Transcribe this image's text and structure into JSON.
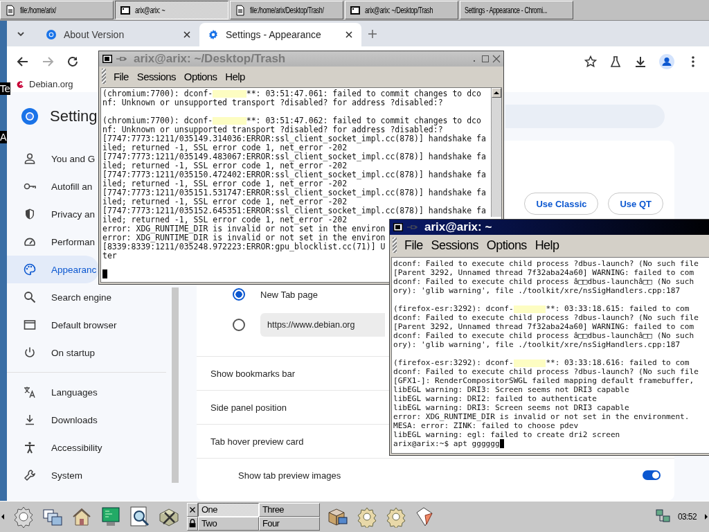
{
  "desktop": {
    "edge_labels": [
      "Te",
      "A"
    ]
  },
  "top_taskbar": {
    "tasks": [
      {
        "label": "file:/home/arix/",
        "kind": "document",
        "selected": false
      },
      {
        "label": "arix@arix: ~",
        "kind": "terminal",
        "selected": true
      },
      {
        "label": "file:/home/arix/Desktop/Trash/",
        "kind": "document",
        "selected": false
      },
      {
        "label": "arix@arix: ~/Desktop/Trash",
        "kind": "terminal",
        "selected": false
      },
      {
        "label": "Settings - Appearance - Chromi...",
        "kind": "none",
        "selected": false
      }
    ]
  },
  "browser": {
    "tabs": [
      {
        "label": "About Version",
        "kind": "chromium",
        "selected": false
      },
      {
        "label": "Settings - Appearance",
        "kind": "gear",
        "selected": true
      }
    ],
    "bookmarks": [
      {
        "label": "Debian.org"
      }
    ],
    "settings_title": "Setting",
    "sidebar": {
      "sections": [
        [
          {
            "label": "You and G",
            "kind": "person",
            "selected": false
          },
          {
            "label": "Autofill an",
            "kind": "key",
            "selected": false
          },
          {
            "label": "Privacy an",
            "kind": "shield",
            "selected": false
          },
          {
            "label": "Performan",
            "kind": "gauge",
            "selected": false
          },
          {
            "label": "Appearanc",
            "kind": "palette",
            "selected": true
          },
          {
            "label": "Search engine",
            "kind": "search",
            "selected": false
          },
          {
            "label": "Default browser",
            "kind": "browser",
            "selected": false
          },
          {
            "label": "On startup",
            "kind": "power",
            "selected": false
          }
        ],
        [
          {
            "label": "Languages",
            "kind": "translate",
            "selected": false
          },
          {
            "label": "Downloads",
            "kind": "download",
            "selected": false
          },
          {
            "label": "Accessibility",
            "kind": "accessibility",
            "selected": false
          },
          {
            "label": "System",
            "kind": "wrench",
            "selected": false
          }
        ]
      ]
    },
    "theme_buttons": [
      "Use Classic",
      "Use QT"
    ],
    "home_options": [
      {
        "label": "New Tab page",
        "kind": "text",
        "selected": true
      },
      {
        "label": "https://www.debian.org",
        "kind": "field",
        "selected": false
      }
    ],
    "rows": [
      {
        "label": "Show bookmarks bar",
        "kind": "plain"
      },
      {
        "label": "Side panel position",
        "kind": "plain"
      },
      {
        "label": "Tab hover preview card",
        "kind": "plain"
      },
      {
        "label": "Show tab preview images",
        "kind": "toggle",
        "on": true
      }
    ]
  },
  "terminals": [
    {
      "title": "arix@arix: ~/Desktop/Trash",
      "active": false,
      "menu": [
        "File",
        "Sessions",
        "Options",
        "Help"
      ],
      "lines": [
        {
          "kind": "redacted",
          "before": "(chromium:7700): dconf-",
          "after": "**: 03:51:47.061: failed to commit changes to dco"
        },
        {
          "kind": "text",
          "text": "nf: Unknown or unsupported transport ?disabled? for address ?disabled:?"
        },
        {
          "kind": "blank"
        },
        {
          "kind": "redacted",
          "before": "(chromium:7700): dconf-",
          "after": "**: 03:51:47.062: failed to commit changes to dco"
        },
        {
          "kind": "text",
          "text": "nf: Unknown or unsupported transport ?disabled? for address ?disabled:?"
        },
        {
          "kind": "text",
          "text": "[7747:7773:1211/035149.314036:ERROR:ssl_client_socket_impl.cc(878)] handshake fa"
        },
        {
          "kind": "text",
          "text": "iled; returned -1, SSL error code 1, net_error -202"
        },
        {
          "kind": "text",
          "text": "[7747:7773:1211/035149.483067:ERROR:ssl_client_socket_impl.cc(878)] handshake fa"
        },
        {
          "kind": "text",
          "text": "iled; returned -1, SSL error code 1, net_error -202"
        },
        {
          "kind": "text",
          "text": "[7747:7773:1211/035150.472402:ERROR:ssl_client_socket_impl.cc(878)] handshake fa"
        },
        {
          "kind": "text",
          "text": "iled; returned -1, SSL error code 1, net_error -202"
        },
        {
          "kind": "text",
          "text": "[7747:7773:1211/035151.531747:ERROR:ssl_client_socket_impl.cc(878)] handshake fa"
        },
        {
          "kind": "text",
          "text": "iled; returned -1, SSL error code 1, net_error -202"
        },
        {
          "kind": "text",
          "text": "[7747:7773:1211/035152.645351:ERROR:ssl_client_socket_impl.cc(878)] handshake fa"
        },
        {
          "kind": "text",
          "text": "iled; returned -1, SSL error code 1, net_error -202"
        },
        {
          "kind": "text",
          "text": "error: XDG_RUNTIME_DIR is invalid or not set in the environ"
        },
        {
          "kind": "text",
          "text": "error: XDG_RUNTIME_DIR is invalid or not set in the environ"
        },
        {
          "kind": "text",
          "text": "[8339:8339:1211/035248.972223:ERROR:gpu_blocklist.cc(71)] U"
        },
        {
          "kind": "text",
          "text": "ter"
        },
        {
          "kind": "blank"
        },
        {
          "kind": "cursor"
        }
      ]
    },
    {
      "title": "arix@arix: ~",
      "active": true,
      "menu": [
        "File",
        "Sessions",
        "Options",
        "Help"
      ],
      "lines": [
        {
          "kind": "text",
          "text": "dconf: Failed to execute child process ?dbus-launch? (No such file"
        },
        {
          "kind": "text",
          "text": "[Parent 3292, Unnamed thread 7f32aba24a60] WARNING: failed to com"
        },
        {
          "kind": "text",
          "text": "dconf: Failed to execute child process â□□dbus-launchâ□□ (No such"
        },
        {
          "kind": "text",
          "text": "ory): 'glib warning', file ./toolkit/xre/nsSigHandlers.cpp:187"
        },
        {
          "kind": "blank"
        },
        {
          "kind": "redacted",
          "before": "(firefox-esr:3292): dconf-",
          "after": "**: 03:33:18.615: failed to com"
        },
        {
          "kind": "text",
          "text": "dconf: Failed to execute child process ?dbus-launch? (No such file"
        },
        {
          "kind": "text",
          "text": "[Parent 3292, Unnamed thread 7f32aba24a60] WARNING: failed to com"
        },
        {
          "kind": "text",
          "text": "dconf: Failed to execute child process â□□dbus-launchâ□□ (No such"
        },
        {
          "kind": "text",
          "text": "ory): 'glib warning', file ./toolkit/xre/nsSigHandlers.cpp:187"
        },
        {
          "kind": "blank"
        },
        {
          "kind": "redacted",
          "before": "(firefox-esr:3292): dconf-",
          "after": "**: 03:33:18.616: failed to com"
        },
        {
          "kind": "text",
          "text": "dconf: Failed to execute child process ?dbus-launch? (No such file"
        },
        {
          "kind": "text",
          "text": "[GFX1-]: RenderCompositorSWGL failed mapping default framebuffer,"
        },
        {
          "kind": "text",
          "text": "libEGL warning: DRI3: Screen seems not DRI3 capable"
        },
        {
          "kind": "text",
          "text": "libEGL warning: DRI2: failed to authenticate"
        },
        {
          "kind": "text",
          "text": "libEGL warning: DRI3: Screen seems not DRI3 capable"
        },
        {
          "kind": "text",
          "text": "error: XDG_RUNTIME_DIR is invalid or not set in the environment."
        },
        {
          "kind": "text",
          "text": "MESA: error: ZINK: failed to choose pdev"
        },
        {
          "kind": "text",
          "text": "libEGL warning: egl: failed to create dri2 screen"
        },
        {
          "kind": "prompt",
          "text": "arix@arix:~$ apt gggggg"
        }
      ]
    }
  ],
  "panel": {
    "desktops": [
      {
        "label": "One",
        "selected": true
      },
      {
        "label": "Three",
        "selected": false
      },
      {
        "label": "Two",
        "selected": false
      },
      {
        "label": "Four",
        "selected": false
      }
    ],
    "clock": "03:52"
  }
}
